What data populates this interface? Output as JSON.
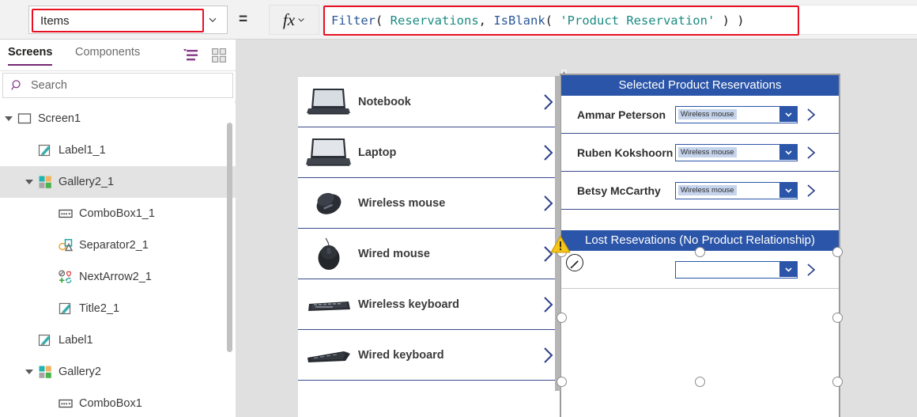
{
  "formula_bar": {
    "property_value": "Items",
    "equals": "=",
    "fx_label": "fx",
    "formula_parts": [
      {
        "t": "Filter",
        "k": "fn"
      },
      {
        "t": "( ",
        "k": "p"
      },
      {
        "t": "Reservations",
        "k": "id"
      },
      {
        "t": ", ",
        "k": "p"
      },
      {
        "t": "IsBlank",
        "k": "fn"
      },
      {
        "t": "( ",
        "k": "p"
      },
      {
        "t": "'Product Reservation'",
        "k": "id"
      },
      {
        "t": " ) )",
        "k": "p"
      }
    ],
    "formula_text": "Filter( Reservations, IsBlank( 'Product Reservation' ) )",
    "accent_red": "#e81123"
  },
  "tree_panel": {
    "tabs": [
      {
        "label": "Screens",
        "active": true
      },
      {
        "label": "Components",
        "active": false
      }
    ],
    "toolbar_icons": [
      "filter-list-icon",
      "grid-view-icon"
    ],
    "search": {
      "placeholder": "Search",
      "value": ""
    },
    "items": [
      {
        "label": "Screen1",
        "icon": "screen-icon",
        "indent": 0,
        "caret": "open",
        "selected": false
      },
      {
        "label": "Label1_1",
        "icon": "label-icon",
        "indent": 1,
        "caret": "none",
        "selected": false
      },
      {
        "label": "Gallery2_1",
        "icon": "gallery-icon",
        "indent": 1,
        "caret": "open",
        "selected": true
      },
      {
        "label": "ComboBox1_1",
        "icon": "combobox-icon",
        "indent": 2,
        "caret": "none",
        "selected": false
      },
      {
        "label": "Separator2_1",
        "icon": "shapes-icon",
        "indent": 2,
        "caret": "none",
        "selected": false
      },
      {
        "label": "NextArrow2_1",
        "icon": "icons-icon",
        "indent": 2,
        "caret": "none",
        "selected": false
      },
      {
        "label": "Title2_1",
        "icon": "label-icon",
        "indent": 2,
        "caret": "none",
        "selected": false
      },
      {
        "label": "Label1",
        "icon": "label-icon",
        "indent": 1,
        "caret": "none",
        "selected": false
      },
      {
        "label": "Gallery2",
        "icon": "gallery-icon",
        "indent": 1,
        "caret": "open",
        "selected": false
      },
      {
        "label": "ComboBox1",
        "icon": "combobox-icon",
        "indent": 2,
        "caret": "none",
        "selected": false
      }
    ]
  },
  "canvas": {
    "product_gallery": {
      "name": "product-gallery",
      "items": [
        {
          "name": "Notebook",
          "image": "notebook-photo"
        },
        {
          "name": "Laptop",
          "image": "laptop-photo"
        },
        {
          "name": "Wireless mouse",
          "image": "wireless-mouse-photo"
        },
        {
          "name": "Wired mouse",
          "image": "wired-mouse-photo"
        },
        {
          "name": "Wireless keyboard",
          "image": "wireless-keyboard-photo"
        },
        {
          "name": "Wired keyboard",
          "image": "wired-keyboard-photo"
        }
      ],
      "arrow_icon": "chevron-right-icon"
    },
    "reservations_gallery": {
      "header": "Selected Product Reservations",
      "rows": [
        {
          "person": "Ammar Peterson",
          "product": "Wireless mouse"
        },
        {
          "person": "Ruben Kokshoorn",
          "product": "Wireless mouse"
        },
        {
          "person": "Betsy McCarthy",
          "product": "Wireless mouse"
        }
      ],
      "lost_header": "Lost Resevations (No Product Relationship)",
      "lost_row": {
        "person": "",
        "product": ""
      },
      "header_color": "#2b55a8",
      "selected": true,
      "warning_icon": "warning-triangle-icon",
      "edit_badge_icon": "pencil-edit-icon"
    }
  }
}
